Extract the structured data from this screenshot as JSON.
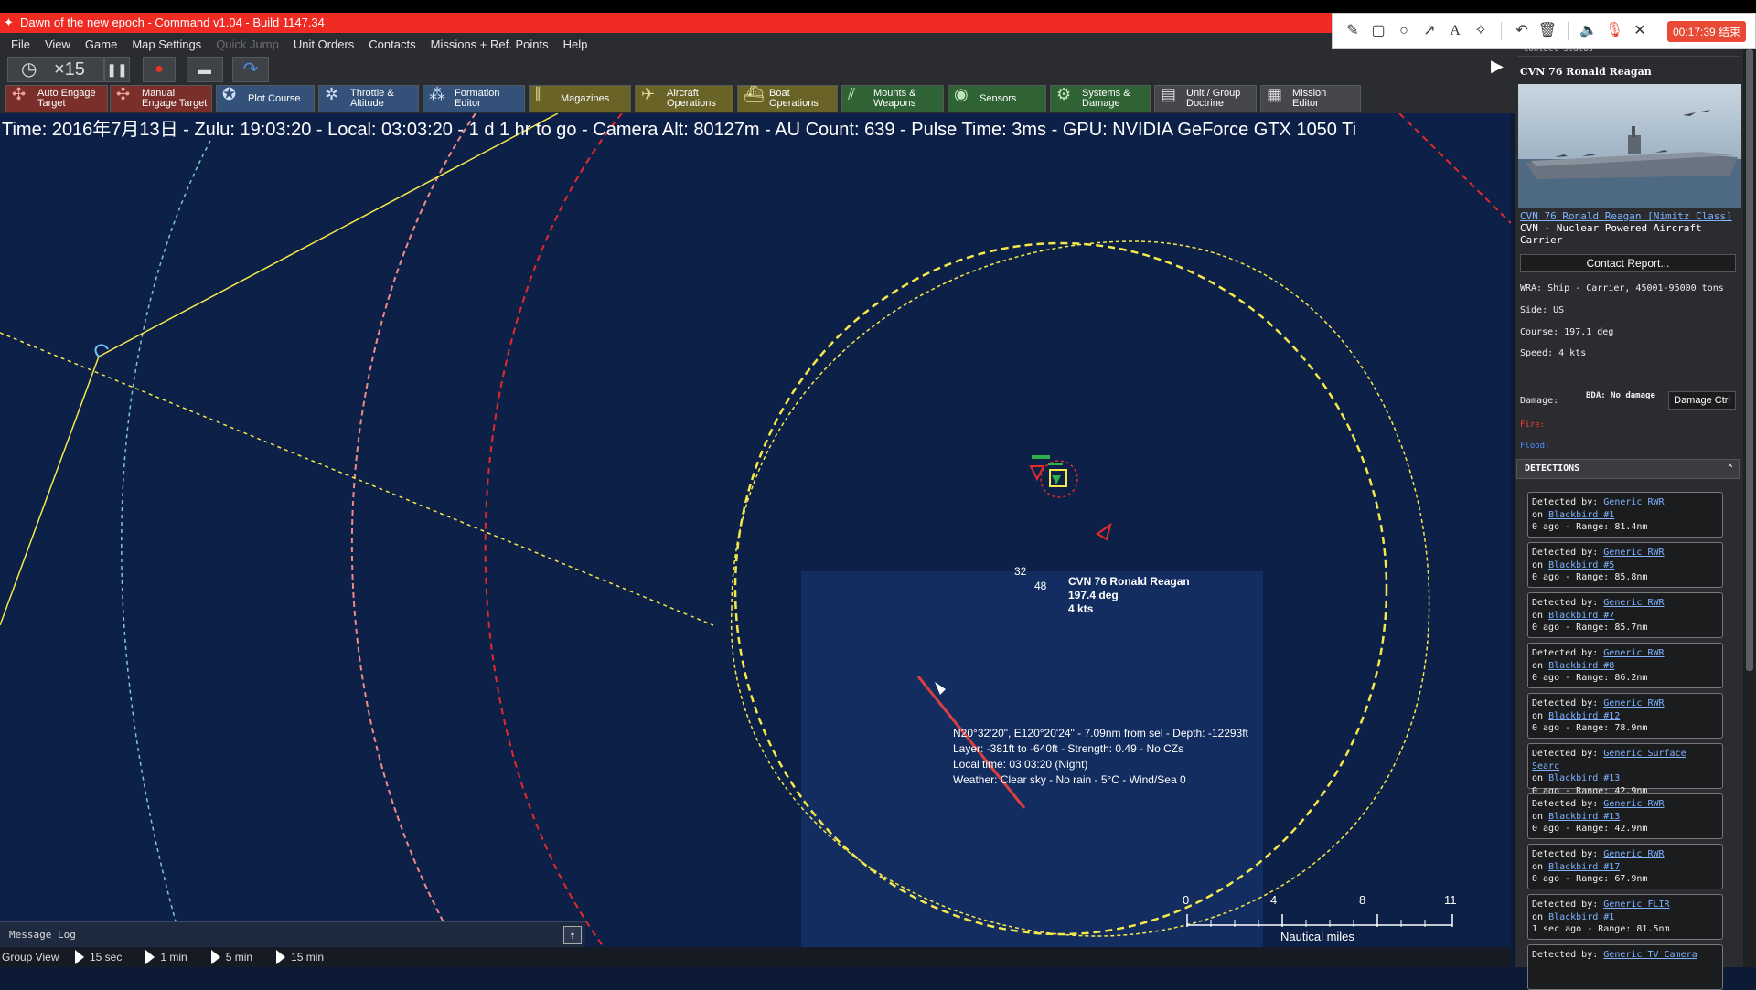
{
  "window": {
    "title": "Dawn of the new epoch - Command v1.04 - Build 1147.34"
  },
  "annotation_toolbar": {
    "timer": "00:17:39 结束"
  },
  "menu": [
    {
      "label": "File",
      "enabled": true
    },
    {
      "label": "View",
      "enabled": true
    },
    {
      "label": "Game",
      "enabled": true
    },
    {
      "label": "Map Settings",
      "enabled": true
    },
    {
      "label": "Quick Jump",
      "enabled": false
    },
    {
      "label": "Unit Orders",
      "enabled": true
    },
    {
      "label": "Contacts",
      "enabled": true
    },
    {
      "label": "Missions + Ref. Points",
      "enabled": true
    },
    {
      "label": "Help",
      "enabled": true
    }
  ],
  "controls": {
    "time_compression": "×15"
  },
  "toolbar": {
    "auto_engage": "Auto Engage|Target",
    "manual_engage": "Manual|Engage Target",
    "plot_course": "Plot Course",
    "throttle": "Throttle &|Altitude",
    "formation": "Formation|Editor",
    "magazines": "Magazines",
    "aircraft_ops": "Aircraft|Operations",
    "boat_ops": "Boat|Operations",
    "mounts": "Mounts &|Weapons",
    "sensors": "Sensors",
    "systems": "Systems &|Damage",
    "doctrine": "Unit / Group|Doctrine",
    "mission_editor": "Mission|Editor"
  },
  "status_line": "Time: 2016年7月13日 - Zulu: 19:03:20 - Local: 03:03:20 - 1 d 1 hr to go -  Camera Alt: 80127m  - AU Count: 639 - Pulse Time: 3ms - GPU: NVIDIA GeForce GTX 1050 Ti",
  "map": {
    "unit_name": "CVN 76 Ronald Reagan",
    "unit_course": "197.4 deg",
    "unit_speed": "4 kts",
    "marker_a": "32",
    "marker_b": "48",
    "tooltip": [
      "N20°32'20\", E120°20'24\" - 7.09nm from sel - Depth: -12293ft",
      "Layer: -381ft to -640ft - Strength: 0.49 - No CZs",
      "Local time: 03:03:20 (Night)",
      "Weather: Clear sky - No rain - 5°C - Wind/Sea 0"
    ],
    "scale": {
      "ticks": [
        "0",
        "4",
        "8",
        "11"
      ],
      "unit": "Nautical miles"
    }
  },
  "message_log": {
    "label": "Message Log"
  },
  "bottom": {
    "group_view": "Group View",
    "time_steps": [
      "15 sec",
      "1 min",
      "5 min",
      "15 min"
    ]
  },
  "side_panel": {
    "header": "Contact Status",
    "name": "CVN 76 Ronald Reagan",
    "class_link": "CVN 76 Ronald Reagan [Nimitz Class]",
    "class_desc": "CVN - Nuclear Powered Aircraft Carrier",
    "contact_report": "Contact Report...",
    "wra": "WRA: Ship - Carrier, 45001-95000 tons",
    "side": "Side: US",
    "course": "Course: 197.1 deg",
    "speed": "Speed: 4 kts",
    "damage_label": "Damage:",
    "bda": "BDA: No damage",
    "damage_ctrl": "Damage Ctrl",
    "fire": "Fire:",
    "flood": "Flood:",
    "detections_header": "DETECTIONS",
    "detections": [
      {
        "sensor": "Generic RWR",
        "platform": "Blackbird #1",
        "age": "0 ago",
        "range": "Range: 81.4nm"
      },
      {
        "sensor": "Generic RWR",
        "platform": "Blackbird #5",
        "age": "0 ago",
        "range": "Range: 85.8nm"
      },
      {
        "sensor": "Generic RWR",
        "platform": "Blackbird #7",
        "age": "0 ago",
        "range": "Range: 85.7nm"
      },
      {
        "sensor": "Generic RWR",
        "platform": "Blackbird #8",
        "age": "0 ago",
        "range": "Range: 86.2nm"
      },
      {
        "sensor": "Generic RWR",
        "platform": "Blackbird #12",
        "age": "0 ago",
        "range": "Range: 78.9nm"
      },
      {
        "sensor": "Generic Surface Searc",
        "platform": "Blackbird #13",
        "age": "0 ago",
        "range": "Range: 42.9nm"
      },
      {
        "sensor": "Generic RWR",
        "platform": "Blackbird #13",
        "age": "0 ago",
        "range": "Range: 42.9nm"
      },
      {
        "sensor": "Generic RWR",
        "platform": "Blackbird #17",
        "age": "0 ago",
        "range": "Range: 67.9nm"
      },
      {
        "sensor": "Generic FLIR",
        "platform": "Blackbird #1",
        "age": "1 sec ago",
        "range": " Range: 81.5nm"
      },
      {
        "sensor": "Generic TV Camera",
        "platform": "",
        "age": "",
        "range": ""
      }
    ]
  }
}
